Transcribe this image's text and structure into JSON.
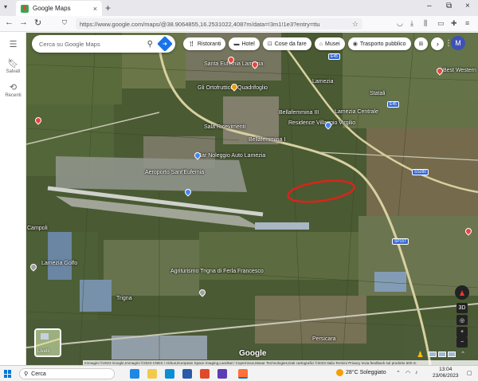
{
  "browser": {
    "tab_title": "Google Maps",
    "tab_close": "×",
    "new_tab": "+",
    "url": "https://www.google.com/maps/@38.9064855,16.2531022,4087m/data=!3m1!1e3?entry=ttu",
    "window_controls": [
      "–",
      "⧉",
      "×"
    ]
  },
  "sidebar": {
    "menu_icon": "menu-icon",
    "items": [
      {
        "label": "Salvati",
        "icon": "bookmark-icon"
      },
      {
        "label": "Recenti",
        "icon": "history-icon"
      }
    ]
  },
  "search": {
    "placeholder": "Cerca su Google Maps",
    "search_icon": "search-icon",
    "directions_icon": "directions-icon"
  },
  "chips": [
    {
      "label": "Ristoranti",
      "icon": "restaurant-icon"
    },
    {
      "label": "Hotel",
      "icon": "hotel-icon"
    },
    {
      "label": "Cose da fare",
      "icon": "things-to-do-icon"
    },
    {
      "label": "Musei",
      "icon": "museum-icon"
    },
    {
      "label": "Trasporto pubblico",
      "icon": "transit-icon"
    },
    {
      "label": "",
      "icon": "more-icon"
    }
  ],
  "account_initial": "M",
  "map_labels": {
    "l1": "Santa Eufemia Lamezia",
    "l2": "Gli Ortofrutticoli Quadrifoglio",
    "l3": "Sala Ricevimenti",
    "l4": "Bellafemmina III",
    "l5": "Residence Villaggio Virgilio",
    "l6": "Bellafemmina I",
    "l7": "Car Noleggio Auto Lamezia",
    "l8": "Aeroporto Sant'Eufemia",
    "l9": "Lamezia Golfo",
    "l10": "Agriturismo Trigna di Ferla Francesco",
    "l11": "Trigna",
    "l12": "Persicara",
    "l13": "Best Western",
    "l14": "Lamezia",
    "l15": "Lamezia Centrale",
    "l16": "Statali",
    "l17": "Campoli"
  },
  "road_badges": [
    "E45",
    "E45",
    "SS280",
    "SP157"
  ],
  "layers_label": "Livelli",
  "google_logo": "Google",
  "zoom_in": "+",
  "zoom_out": "−",
  "three_d": "3D",
  "attribution": "Immagini ©2023 Google,Immagini ©2023 CNES / Airbus,European Space Imaging,Landsat / Copernicus,Maxar Technologies,Dati cartografici ©2023   Italia   Termini   Privacy   Invia feedback sul prodotto   500 m",
  "taskbar": {
    "search_label": "Cerca",
    "weather": "28°C  Soleggiato",
    "time": "13:04",
    "date": "23/06/2023",
    "tray_lang": "ITA"
  },
  "colors": {
    "annotation_ring": "#d9241c",
    "accent": "#1a73e8"
  }
}
